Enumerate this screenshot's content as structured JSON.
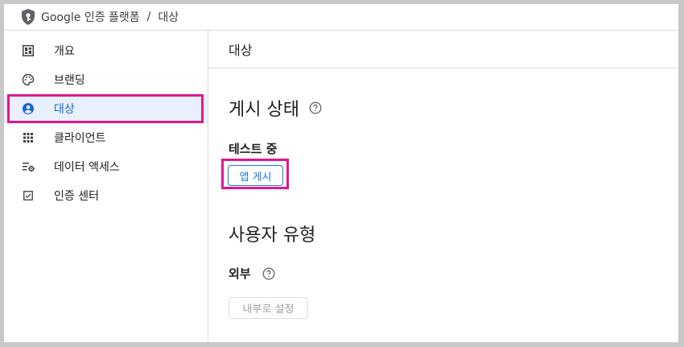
{
  "breadcrumb": {
    "product": "Google 인증 플랫폼",
    "separator": "/",
    "current": "대상"
  },
  "sidebar": {
    "items": [
      {
        "label": "개요",
        "icon": "dashboard-icon"
      },
      {
        "label": "브랜딩",
        "icon": "palette-icon"
      },
      {
        "label": "대상",
        "icon": "account-circle-icon",
        "active": true
      },
      {
        "label": "클라이언트",
        "icon": "apps-grid-icon"
      },
      {
        "label": "데이터 액세스",
        "icon": "data-settings-icon"
      },
      {
        "label": "인증 센터",
        "icon": "verified-checkbox-icon"
      }
    ]
  },
  "main": {
    "header_title": "대상",
    "publish_section": {
      "title": "게시 상태",
      "status": "테스트 중",
      "button_label": "앱 게시"
    },
    "user_type_section": {
      "title": "사용자 유형",
      "type": "외부",
      "button_label": "내부로 설정"
    }
  },
  "colors": {
    "accent": "#1a73e8",
    "active_bg": "#e8f0fe",
    "highlight": "#e0168e"
  }
}
